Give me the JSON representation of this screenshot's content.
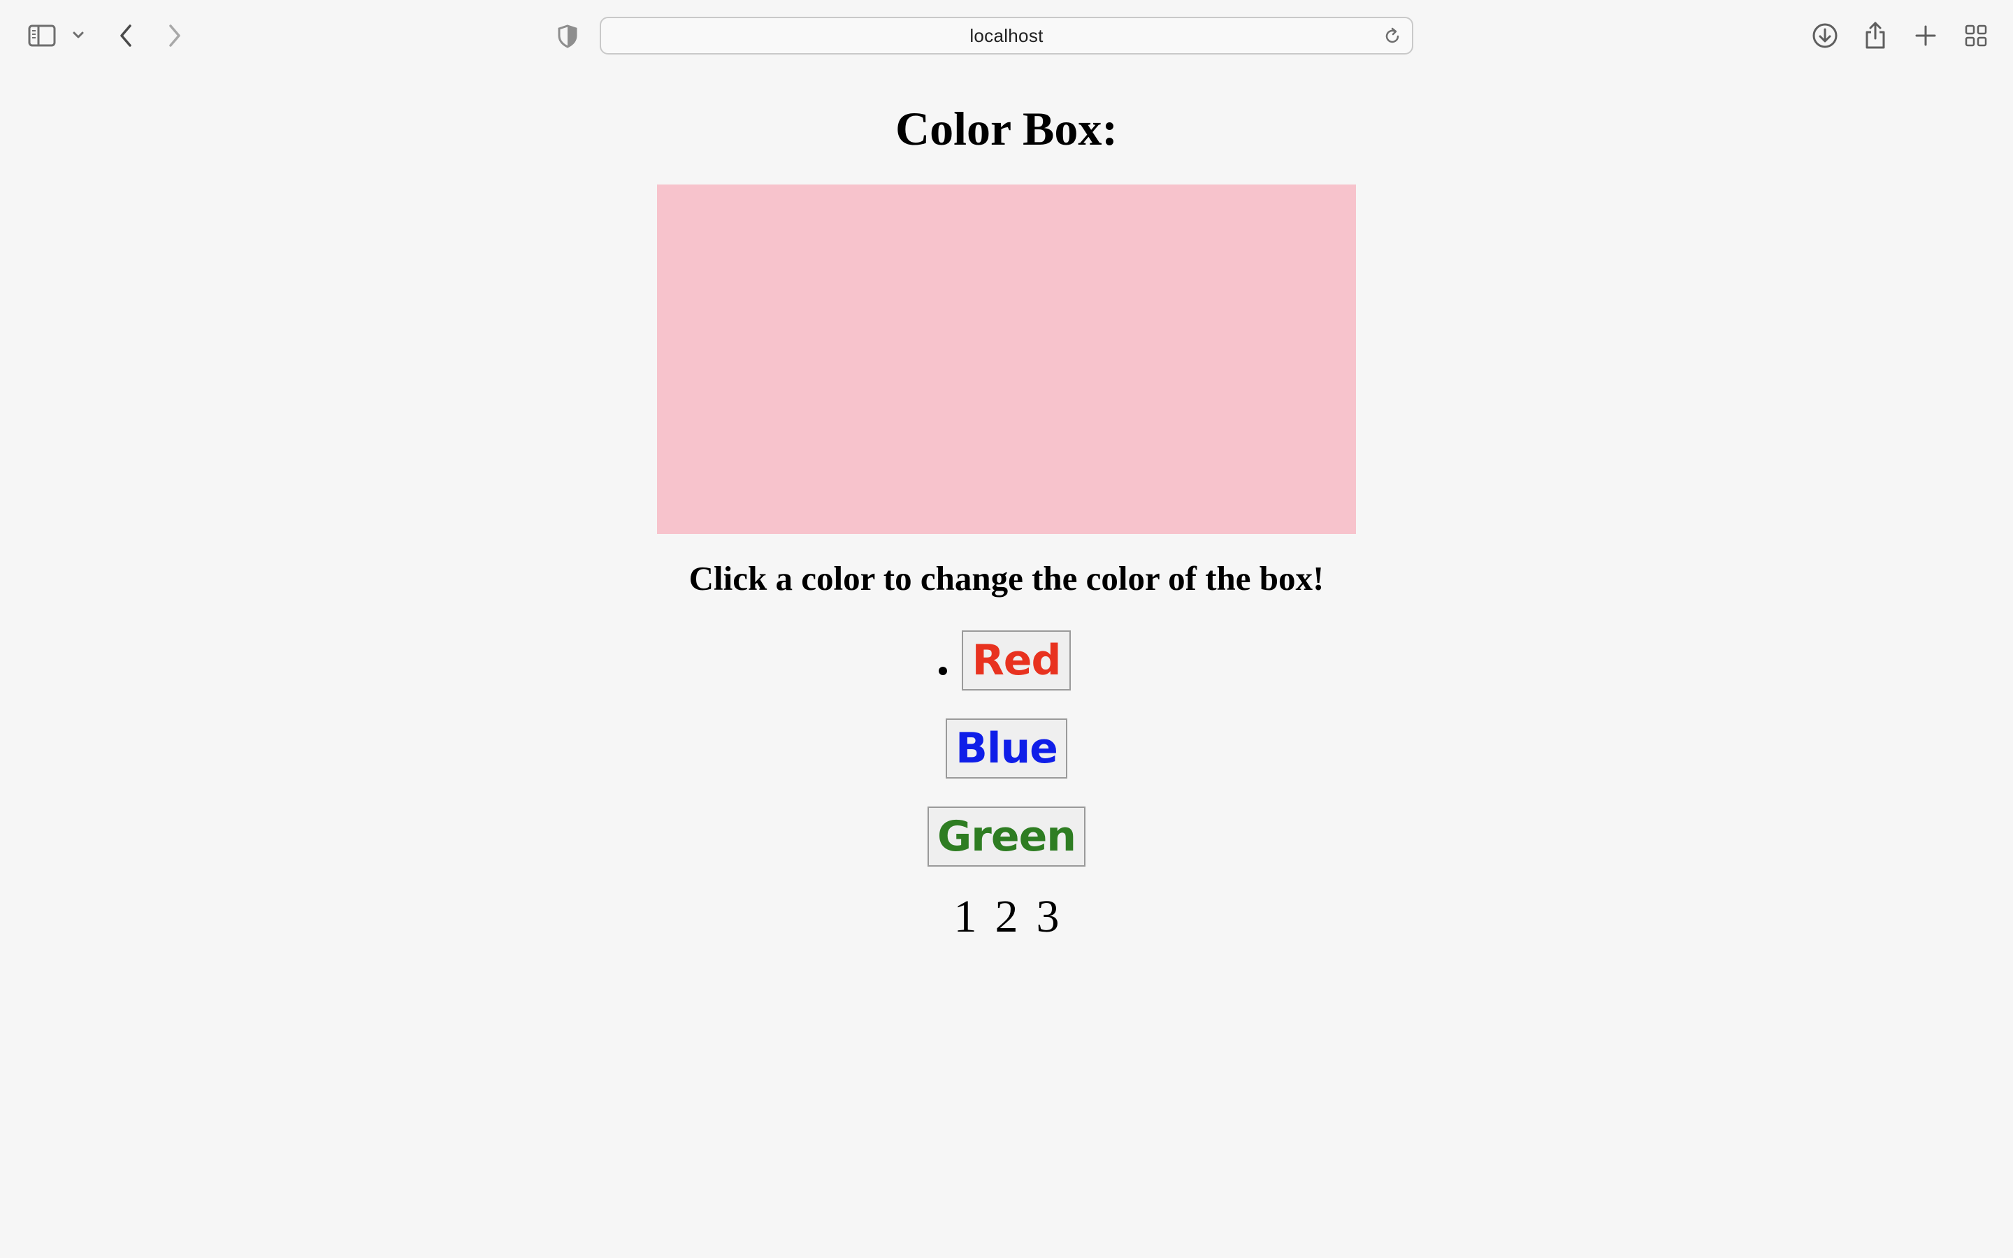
{
  "browser": {
    "url": "localhost",
    "icons": {
      "sidebar": "sidebar-toggle-icon",
      "sidebar_menu": "chevron-down-icon",
      "back": "back-arrow-icon",
      "forward": "forward-arrow-icon",
      "privacy": "shield-icon",
      "reload": "reload-icon",
      "downloads": "download-icon",
      "share": "share-icon",
      "new_tab": "plus-icon",
      "tab_overview": "grid-icon"
    }
  },
  "page": {
    "title": "Color Box:",
    "box_color": "#f7c3cc",
    "instructions": "Click a color to change the color of the box!",
    "color_buttons": [
      {
        "label": "Red",
        "color": "#e8321f"
      },
      {
        "label": "Blue",
        "color": "#0f1ee8"
      },
      {
        "label": "Green",
        "color": "#2e7d22"
      }
    ],
    "pagination": [
      "1",
      "2",
      "3"
    ]
  }
}
